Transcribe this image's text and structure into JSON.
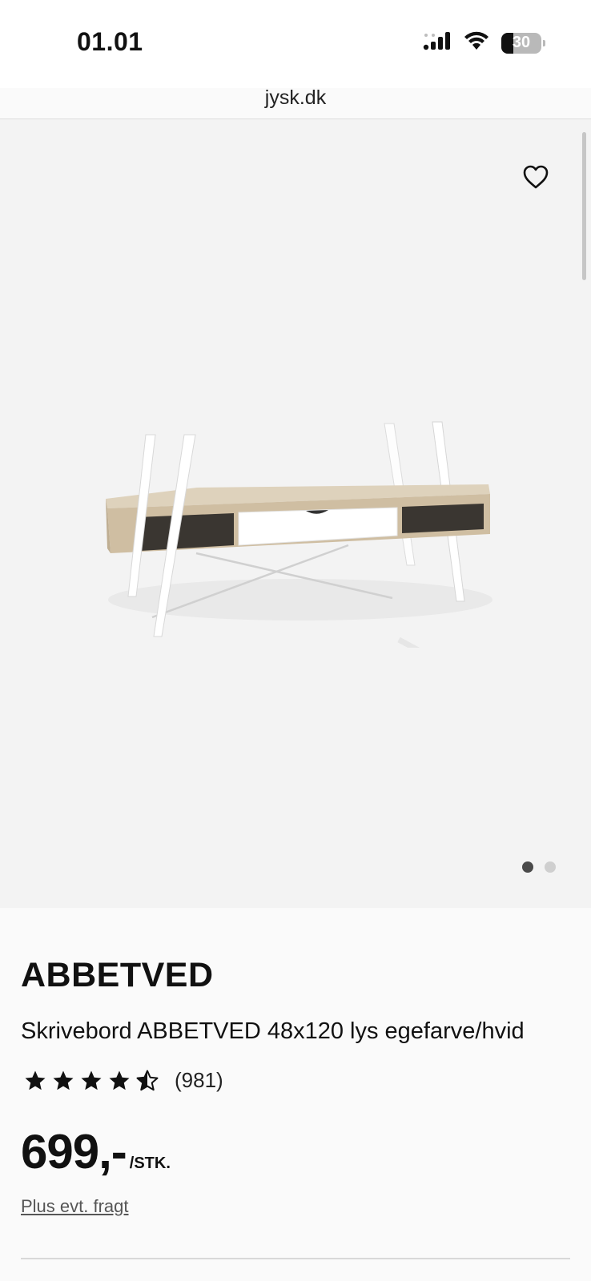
{
  "status_bar": {
    "time": "01.01",
    "battery_level": "30",
    "battery_fraction": 0.3
  },
  "browser": {
    "url": "jysk.dk"
  },
  "gallery": {
    "image_alt": "Skrivebord ABBETVED",
    "slide_count": 2,
    "active_slide": 1
  },
  "product": {
    "brand": "ABBETVED",
    "name": "Skrivebord ABBETVED 48x120 lys egefarve/hvid",
    "rating_value": 4.5,
    "rating_max": 5,
    "review_count": "(981)",
    "price": "699,-",
    "unit": "/STK.",
    "shipping_note": "Plus evt. fragt"
  },
  "colors": {
    "gallery_bg": "#f3f3f3",
    "text": "#111111",
    "oak": "#d8c9b0",
    "desk_white": "#ffffff"
  },
  "icons": {
    "favorite": "heart-icon",
    "star": "star-icon",
    "signal": "signal-icon",
    "wifi": "wifi-icon",
    "battery": "battery-icon"
  }
}
